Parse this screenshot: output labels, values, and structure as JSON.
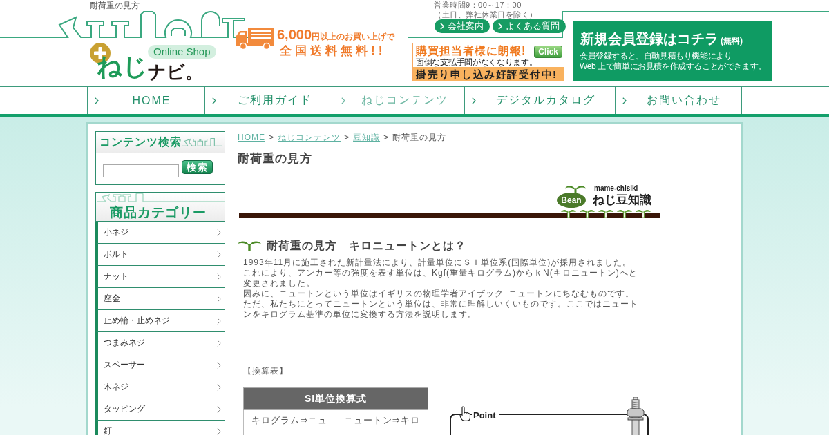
{
  "page_title": "耐荷重の見方",
  "logo": {
    "mark": "ねじ",
    "name": "ナビ。",
    "badge": "Online Shop"
  },
  "shipping_banner": {
    "amount": "6,000",
    "condition": "円以上のお買い上げで",
    "headline": "全国送料無料!!"
  },
  "business_hours": [
    "営業時間9：00～17：00",
    "（土日、弊社休業日を除く）"
  ],
  "header_links": [
    {
      "label": "会社案内"
    },
    {
      "label": "よくある質問"
    }
  ],
  "credit_banner": {
    "title": "購買担当者様に朗報!",
    "subtitle": "面倒な支払手間がなくなります。",
    "button": "Click",
    "footer": "掛売り申し込み好評受付中!"
  },
  "register_banner": {
    "title": "新規会員登録はコチラ",
    "note": "(無料)",
    "description": [
      "会員登録すると、自動見積もり機能により",
      "Web 上で簡単にお見積を作成することができます。"
    ]
  },
  "nav": [
    {
      "label": "HOME",
      "selected": false
    },
    {
      "label": "ご利用ガイド",
      "selected": false
    },
    {
      "label": "ねじコンテンツ",
      "selected": true
    },
    {
      "label": "デジタルカタログ",
      "selected": false
    },
    {
      "label": "お問い合わせ",
      "selected": false
    }
  ],
  "sidebar": {
    "search": {
      "title": "コンテンツ検索",
      "button": "検索"
    },
    "categories": {
      "title": "商品カテゴリー",
      "items": [
        {
          "label": "小ネジ",
          "hovered": false
        },
        {
          "label": "ボルト",
          "hovered": false
        },
        {
          "label": "ナット",
          "hovered": false
        },
        {
          "label": "座金",
          "hovered": true
        },
        {
          "label": "止め輪・止めネジ",
          "hovered": false
        },
        {
          "label": "つまみネジ",
          "hovered": false
        },
        {
          "label": "スペーサー",
          "hovered": false
        },
        {
          "label": "木ネジ",
          "hovered": false
        },
        {
          "label": "タッピング",
          "hovered": false
        },
        {
          "label": "釘",
          "hovered": false
        }
      ]
    }
  },
  "breadcrumb": [
    {
      "label": "HOME",
      "kind": "link"
    },
    {
      "label": ">",
      "kind": "separator"
    },
    {
      "label": "ねじコンテンツ",
      "kind": "link"
    },
    {
      "label": ">",
      "kind": "separator"
    },
    {
      "label": "豆知識",
      "kind": "link"
    },
    {
      "label": ">",
      "kind": "separator"
    },
    {
      "label": "耐荷重の見方",
      "kind": "current"
    }
  ],
  "title": "耐荷重の見方",
  "bean_banner": {
    "badge": "Bean",
    "subtitle": "mame-chisiki",
    "title": "ねじ豆知識"
  },
  "article": {
    "heading": "耐荷重の見方　キロニュートンとは？",
    "paragraph": [
      "1993年11月に施工された新計量法により、計量単位にＳＩ単位系(国際単位)が採用されました。",
      "これにより、アンカー等の強度を表す単位は、Kgf(重量キログラム)からｋN(キロニュートン)へと変更されました。",
      "因みに、ニュートンという単位はイギリスの物理学者アイザック･ニュートンにちなむものです。",
      "ただ、私たちにとってニュートンという単位は、非常に理解しいくいものです。ここではニュートンをキログラム基準の単位に変換する方法を説明します。"
    ],
    "table_caption": "【換算表】",
    "table": {
      "header": "SI単位換算式",
      "cells": [
        "キログラム⇒ニュ",
        "ニュートン⇒キロ"
      ]
    },
    "point": {
      "label": "Point"
    }
  }
}
